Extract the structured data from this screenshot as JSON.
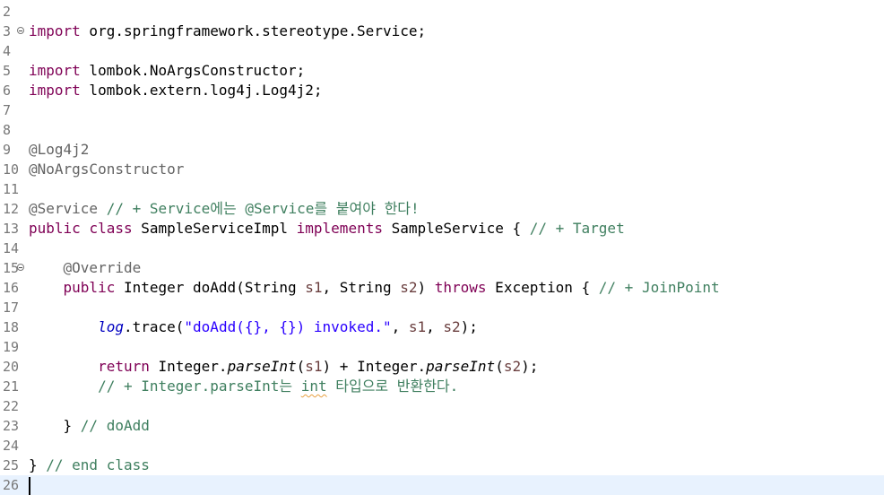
{
  "editor": {
    "line_numbers": [
      "2",
      "3",
      "4",
      "5",
      "6",
      "7",
      "8",
      "9",
      "10",
      "11",
      "12",
      "13",
      "14",
      "15",
      "16",
      "17",
      "18",
      "19",
      "20",
      "21",
      "22",
      "23",
      "24",
      "25",
      "26"
    ],
    "tokens": {
      "import": "import",
      "public": "public",
      "class": "class",
      "implements": "implements",
      "throws": "throws",
      "return": "return",
      "semicolon": ";",
      "l3_pkg": " org.springframework.stereotype.Service",
      "l5_pkg": " lombok.NoArgsConstructor",
      "l6_pkg": " lombok.extern.log4j.Log4j2",
      "l9_ann": "@Log4j2",
      "l10_ann": "@NoArgsConstructor",
      "l12_ann": "@Service",
      "l12_comment": " // + Service에는 @Service를 붙여야 한다!",
      "l13_name": " SampleServiceImpl ",
      "l13_iface": " SampleService { ",
      "l13_comment": "// + Target",
      "l15_indent": "    ",
      "l15_ann": "@Override",
      "l16_indent": "    ",
      "l16_sig_a": " Integer doAdd(String ",
      "l16_s1": "s1",
      "l16_sig_b": ", String ",
      "l16_s2": "s2",
      "l16_close": ") ",
      "l16_exc": " Exception { ",
      "l16_comment": "// + JoinPoint",
      "l18_indent": "        ",
      "l18_log": "log",
      "l18_call": ".trace(",
      "l18_str": "\"doAdd({}, {}) invoked.\"",
      "l18_comma1": ", ",
      "l18_s1": "s1",
      "l18_comma2": ", ",
      "l18_s2": "s2",
      "l18_end": ");",
      "l20_indent": "        ",
      "l20_a": " Integer.",
      "l20_parse1": "parseInt",
      "l20_open1": "(",
      "l20_s1": "s1",
      "l20_b": ") + Integer.",
      "l20_parse2": "parseInt",
      "l20_open2": "(",
      "l20_s2": "s2",
      "l20_end": ");",
      "l21_indent": "        ",
      "l21_comment_a": "// + Integer.parseInt는 ",
      "l21_comment_int": "int",
      "l21_comment_b": " 타입으로 반환한다.",
      "l23_indent": "    ",
      "l23_brace": "} ",
      "l23_comment": "// doAdd",
      "l25_brace": "} ",
      "l25_comment": "// end class"
    }
  },
  "colors": {
    "keyword": "#7f0055",
    "annotation": "#646464",
    "comment": "#3f7f5f",
    "string": "#2a00ff",
    "local_variable": "#6a3e3e",
    "static_field": "#0000c0",
    "line_number": "#787878",
    "current_line": "#e8f2fe"
  },
  "icons": {
    "fold_markers": [
      "collapse-icon-line-3",
      "collapse-icon-line-15"
    ]
  }
}
